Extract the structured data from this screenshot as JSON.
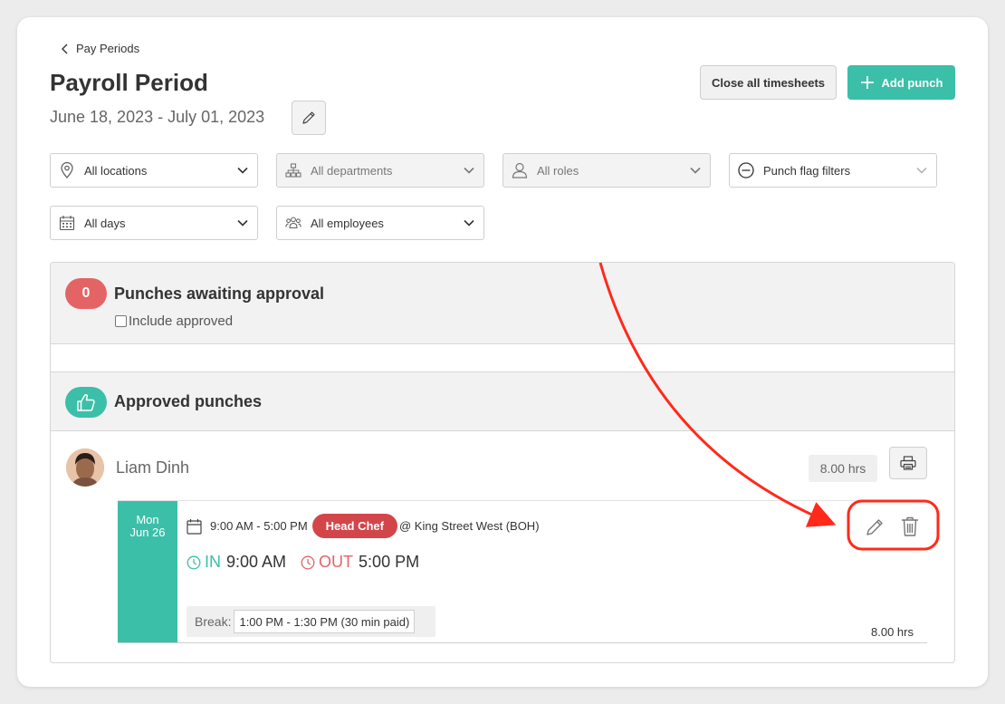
{
  "breadcrumb": {
    "back_label": "Pay Periods"
  },
  "header": {
    "title": "Payroll Period",
    "date_range": "June 18, 2023 - July 01, 2023",
    "close_all_label": "Close all timesheets",
    "add_punch_label": "Add punch"
  },
  "filters": {
    "locations": "All locations",
    "departments": "All departments",
    "roles": "All roles",
    "punch_flags": "Punch flag filters",
    "days": "All days",
    "employees": "All employees"
  },
  "pending": {
    "count": "0",
    "title": "Punches awaiting approval",
    "include_approved_label": "Include approved"
  },
  "approved": {
    "title": "Approved punches"
  },
  "employee": {
    "name": "Liam Dinh",
    "total_hours": "8.00 hrs"
  },
  "punch": {
    "day": "Mon",
    "date": "Jun 26",
    "schedule": "9:00 AM - 5:00 PM",
    "role": "Head Chef",
    "location": "@ King Street West (BOH)",
    "in_label": "IN",
    "in_time": "9:00 AM",
    "out_label": "OUT",
    "out_time": "5:00 PM",
    "break_label": "Break:",
    "break_value": "1:00 PM - 1:30 PM (30 min paid)",
    "hours": "8.00 hrs"
  },
  "colors": {
    "accent": "#3bbfa8",
    "pending_badge": "#e46465",
    "role_badge": "#d2464a",
    "annotation": "#ff2a1a"
  }
}
